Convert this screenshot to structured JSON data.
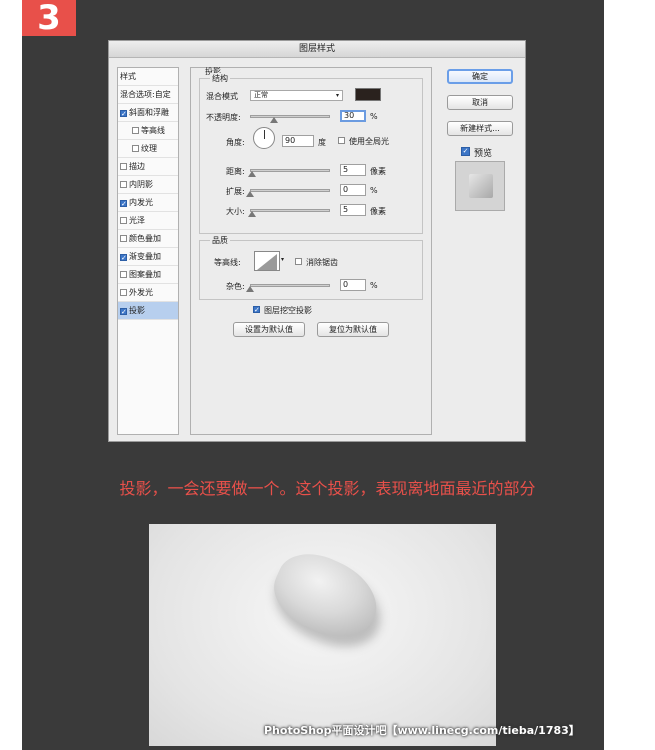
{
  "step_badge": "3",
  "dialog": {
    "title": "图层样式",
    "left_list": [
      {
        "label": "样式",
        "checkbox": false,
        "checked": false,
        "selected": false,
        "sub": false
      },
      {
        "label": "混合选项:自定",
        "checkbox": false,
        "checked": false,
        "selected": false,
        "sub": false
      },
      {
        "label": "斜面和浮雕",
        "checkbox": true,
        "checked": true,
        "selected": false,
        "sub": false
      },
      {
        "label": "等高线",
        "checkbox": true,
        "checked": false,
        "selected": false,
        "sub": true
      },
      {
        "label": "纹理",
        "checkbox": true,
        "checked": false,
        "selected": false,
        "sub": true
      },
      {
        "label": "描边",
        "checkbox": true,
        "checked": false,
        "selected": false,
        "sub": false
      },
      {
        "label": "内阴影",
        "checkbox": true,
        "checked": false,
        "selected": false,
        "sub": false
      },
      {
        "label": "内发光",
        "checkbox": true,
        "checked": true,
        "selected": false,
        "sub": false
      },
      {
        "label": "光泽",
        "checkbox": true,
        "checked": false,
        "selected": false,
        "sub": false
      },
      {
        "label": "颜色叠加",
        "checkbox": true,
        "checked": false,
        "selected": false,
        "sub": false
      },
      {
        "label": "渐变叠加",
        "checkbox": true,
        "checked": true,
        "selected": false,
        "sub": false
      },
      {
        "label": "图案叠加",
        "checkbox": true,
        "checked": false,
        "selected": false,
        "sub": false
      },
      {
        "label": "外发光",
        "checkbox": true,
        "checked": false,
        "selected": false,
        "sub": false
      },
      {
        "label": "投影",
        "checkbox": true,
        "checked": true,
        "selected": true,
        "sub": false
      }
    ],
    "section_title": "投影",
    "structure": {
      "legend": "结构",
      "blend_mode_label": "混合模式",
      "blend_mode_value": "正常",
      "shadow_color": "#2a221e",
      "opacity_label": "不透明度:",
      "opacity_value": "30",
      "opacity_fraction": 0.3,
      "percent_unit": "%",
      "angle_label": "角度:",
      "angle_value": "90",
      "degree_unit": "度",
      "global_light_label": "使用全局光",
      "global_light_checked": false,
      "distance_label": "距离:",
      "distance_value": "5",
      "distance_fraction": 0.02,
      "pixel_unit": "像素",
      "spread_label": "扩展:",
      "spread_value": "0",
      "spread_fraction": 0,
      "size_label": "大小:",
      "size_value": "5",
      "size_fraction": 0.02
    },
    "quality": {
      "legend": "品质",
      "contour_label": "等高线:",
      "antialias_label": "消除锯齿",
      "antialias_checked": false,
      "noise_label": "杂色:",
      "noise_value": "0",
      "noise_fraction": 0
    },
    "knockout_label": "图层挖空投影",
    "knockout_checked": true,
    "set_default_label": "设置为默认值",
    "reset_default_label": "复位为默认值",
    "ok_label": "确定",
    "cancel_label": "取消",
    "new_style_label": "新建样式...",
    "preview_label": "预览",
    "preview_checked": true
  },
  "caption": "投影，一会还要做一个。这个投影，表现离地面最近的部分",
  "watermark": "PhotoShop平面设计吧【www.linecg.com/tieba/1783】",
  "colors": {
    "accent_red": "#e8504a",
    "dark_bg": "#3a3a3a",
    "selection": "#b7cfee"
  }
}
